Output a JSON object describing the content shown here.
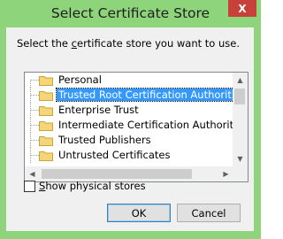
{
  "window": {
    "title": "Select Certificate Store",
    "close_label": "X"
  },
  "prompt": {
    "before": "Select the ",
    "accel": "c",
    "after": "ertificate store you want to use."
  },
  "tree": {
    "items": [
      {
        "label": "Personal",
        "selected": false
      },
      {
        "label": "Trusted Root Certification Authorities",
        "selected": true
      },
      {
        "label": "Enterprise Trust",
        "selected": false
      },
      {
        "label": "Intermediate Certification Authorities",
        "selected": false
      },
      {
        "label": "Trusted Publishers",
        "selected": false
      },
      {
        "label": "Untrusted Certificates",
        "selected": false
      }
    ]
  },
  "show_physical": {
    "accel": "S",
    "rest": "how physical stores",
    "checked": false
  },
  "buttons": {
    "ok": "OK",
    "cancel": "Cancel"
  },
  "colors": {
    "frame": "#8ed47a",
    "selection": "#3399ff",
    "close": "#c7413a"
  }
}
